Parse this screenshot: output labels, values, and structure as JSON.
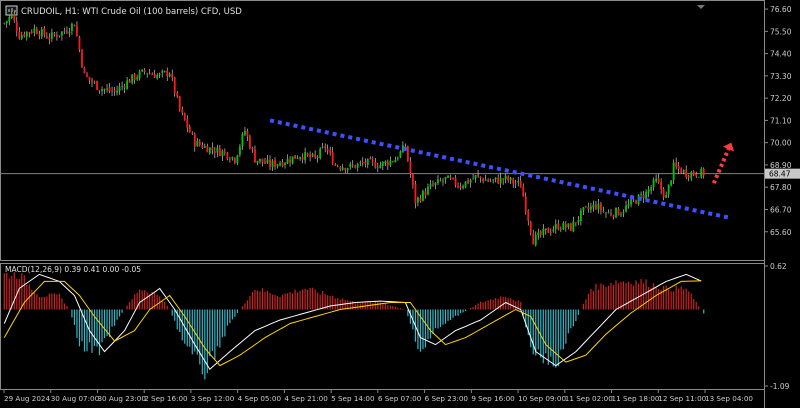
{
  "header": {
    "title": "CRUDOIL, H1:  WTI Crude Oil (100 barrels) CFD, USD",
    "icon": "chart-window-icon"
  },
  "colors": {
    "background": "#000000",
    "bull": "#00c800",
    "bear": "#ff1a1a",
    "wick": "#e6e6e6",
    "trendline": "#3c50ff",
    "arrow": "#ff3c3c",
    "price_line": "#808080",
    "macd_pos": "#d02020",
    "macd_neg": "#30b8c8",
    "main_line": "#ffffff",
    "signal_line": "#ffd600",
    "axis_text": "#cccccc"
  },
  "chart_data": [
    {
      "type": "candlestick",
      "title": "CRUDOIL, H1:  WTI Crude Oil (100 barrels) CFD, USD",
      "ylim": [
        64.6,
        76.8
      ],
      "y_ticks": [
        "76.60",
        "75.50",
        "74.40",
        "73.30",
        "72.20",
        "71.10",
        "70.00",
        "68.90",
        "67.80",
        "66.70",
        "65.60"
      ],
      "x_ticks": [
        "29 Aug 2024",
        "30 Aug 07:00",
        "30 Aug 23:00",
        "2 Sep 16:00",
        "3 Sep 12:00",
        "4 Sep 05:00",
        "4 Sep 21:00",
        "5 Sep 14:00",
        "6 Sep 07:00",
        "6 Sep 23:00",
        "9 Sep 16:00",
        "10 Sep 09:00",
        "11 Sep 02:00",
        "11 Sep 18:00",
        "12 Sep 11:00",
        "13 Sep 04:00"
      ],
      "current_price": 68.47,
      "current_price_label": "68.47",
      "path_points": [
        [
          0,
          75.9
        ],
        [
          3,
          76.3
        ],
        [
          6,
          75.3
        ],
        [
          12,
          75.6
        ],
        [
          18,
          75.2
        ],
        [
          24,
          75.5
        ],
        [
          28,
          75.9
        ],
        [
          32,
          73.3
        ],
        [
          38,
          72.7
        ],
        [
          44,
          72.5
        ],
        [
          50,
          73.1
        ],
        [
          56,
          73.5
        ],
        [
          62,
          73.3
        ],
        [
          66,
          73.5
        ],
        [
          70,
          71.6
        ],
        [
          76,
          70.0
        ],
        [
          82,
          69.7
        ],
        [
          88,
          69.5
        ],
        [
          92,
          69.2
        ],
        [
          96,
          70.6
        ],
        [
          100,
          69.2
        ],
        [
          106,
          68.9
        ],
        [
          112,
          69.1
        ],
        [
          118,
          69.4
        ],
        [
          124,
          69.2
        ],
        [
          128,
          69.8
        ],
        [
          132,
          68.9
        ],
        [
          138,
          68.8
        ],
        [
          144,
          69.0
        ],
        [
          150,
          68.9
        ],
        [
          156,
          69.2
        ],
        [
          160,
          69.8
        ],
        [
          164,
          67.1
        ],
        [
          170,
          67.8
        ],
        [
          176,
          68.2
        ],
        [
          182,
          67.9
        ],
        [
          188,
          68.3
        ],
        [
          194,
          68.1
        ],
        [
          200,
          68.2
        ],
        [
          206,
          67.9
        ],
        [
          211,
          65.2
        ],
        [
          216,
          65.6
        ],
        [
          221,
          65.9
        ],
        [
          226,
          65.8
        ],
        [
          231,
          66.6
        ],
        [
          236,
          66.9
        ],
        [
          240,
          66.5
        ],
        [
          246,
          66.6
        ],
        [
          251,
          67.1
        ],
        [
          256,
          67.5
        ],
        [
          260,
          68.1
        ],
        [
          264,
          67.3
        ],
        [
          267,
          68.8
        ],
        [
          272,
          68.5
        ],
        [
          279,
          68.5
        ]
      ],
      "trendline": {
        "start": [
          106,
          71.1
        ],
        "end": [
          289,
          66.3
        ]
      },
      "arrow": {
        "start": [
          283,
          68.0
        ],
        "end": [
          290,
          70.0
        ]
      }
    },
    {
      "type": "macd",
      "label": "MACD(12,26,9) 0.39 0.41 0.00 -0.05",
      "ylim": [
        -1.09,
        0.62
      ],
      "y_ticks": [
        "0.62",
        "-1.09"
      ],
      "hist_points": [
        [
          0,
          0.5
        ],
        [
          6,
          0.5
        ],
        [
          14,
          0.2
        ],
        [
          22,
          0.2
        ],
        [
          26,
          0.0
        ],
        [
          30,
          -0.5
        ],
        [
          38,
          -0.6
        ],
        [
          46,
          -0.1
        ],
        [
          54,
          0.3
        ],
        [
          62,
          0.2
        ],
        [
          66,
          0.0
        ],
        [
          72,
          -0.5
        ],
        [
          80,
          -0.9
        ],
        [
          90,
          -0.2
        ],
        [
          100,
          0.3
        ],
        [
          110,
          0.2
        ],
        [
          120,
          0.3
        ],
        [
          130,
          0.2
        ],
        [
          140,
          0.1
        ],
        [
          150,
          0.1
        ],
        [
          160,
          0.0
        ],
        [
          166,
          -0.6
        ],
        [
          172,
          -0.3
        ],
        [
          180,
          -0.1
        ],
        [
          190,
          0.1
        ],
        [
          200,
          0.2
        ],
        [
          206,
          0.1
        ],
        [
          210,
          -0.6
        ],
        [
          220,
          -0.8
        ],
        [
          226,
          -0.3
        ],
        [
          234,
          0.3
        ],
        [
          244,
          0.4
        ],
        [
          254,
          0.4
        ],
        [
          264,
          0.3
        ],
        [
          272,
          0.3
        ],
        [
          279,
          -0.05
        ]
      ],
      "main_points": [
        [
          0,
          -0.2
        ],
        [
          6,
          0.3
        ],
        [
          14,
          0.5
        ],
        [
          22,
          0.4
        ],
        [
          28,
          0.2
        ],
        [
          34,
          -0.3
        ],
        [
          40,
          -0.6
        ],
        [
          48,
          -0.3
        ],
        [
          54,
          0.1
        ],
        [
          62,
          0.3
        ],
        [
          68,
          0.0
        ],
        [
          76,
          -0.5
        ],
        [
          82,
          -0.85
        ],
        [
          90,
          -0.6
        ],
        [
          100,
          -0.3
        ],
        [
          110,
          -0.15
        ],
        [
          120,
          -0.05
        ],
        [
          130,
          0.05
        ],
        [
          140,
          0.1
        ],
        [
          150,
          0.12
        ],
        [
          160,
          0.1
        ],
        [
          166,
          -0.4
        ],
        [
          172,
          -0.5
        ],
        [
          180,
          -0.3
        ],
        [
          190,
          -0.15
        ],
        [
          200,
          0.1
        ],
        [
          206,
          0.0
        ],
        [
          212,
          -0.6
        ],
        [
          220,
          -0.8
        ],
        [
          228,
          -0.6
        ],
        [
          236,
          -0.3
        ],
        [
          244,
          0.0
        ],
        [
          254,
          0.2
        ],
        [
          264,
          0.4
        ],
        [
          272,
          0.5
        ],
        [
          279,
          0.39
        ]
      ],
      "signal_points": [
        [
          0,
          -0.4
        ],
        [
          8,
          0.1
        ],
        [
          16,
          0.4
        ],
        [
          24,
          0.4
        ],
        [
          30,
          0.2
        ],
        [
          36,
          -0.1
        ],
        [
          44,
          -0.45
        ],
        [
          52,
          -0.3
        ],
        [
          58,
          0.0
        ],
        [
          66,
          0.2
        ],
        [
          72,
          -0.1
        ],
        [
          80,
          -0.55
        ],
        [
          86,
          -0.8
        ],
        [
          94,
          -0.65
        ],
        [
          104,
          -0.4
        ],
        [
          114,
          -0.2
        ],
        [
          124,
          -0.1
        ],
        [
          134,
          0.0
        ],
        [
          144,
          0.05
        ],
        [
          154,
          0.1
        ],
        [
          162,
          0.1
        ],
        [
          170,
          -0.3
        ],
        [
          176,
          -0.5
        ],
        [
          184,
          -0.4
        ],
        [
          194,
          -0.2
        ],
        [
          204,
          0.0
        ],
        [
          210,
          -0.1
        ],
        [
          216,
          -0.5
        ],
        [
          224,
          -0.75
        ],
        [
          232,
          -0.65
        ],
        [
          240,
          -0.35
        ],
        [
          250,
          -0.05
        ],
        [
          260,
          0.2
        ],
        [
          270,
          0.4
        ],
        [
          279,
          0.41
        ]
      ]
    }
  ]
}
